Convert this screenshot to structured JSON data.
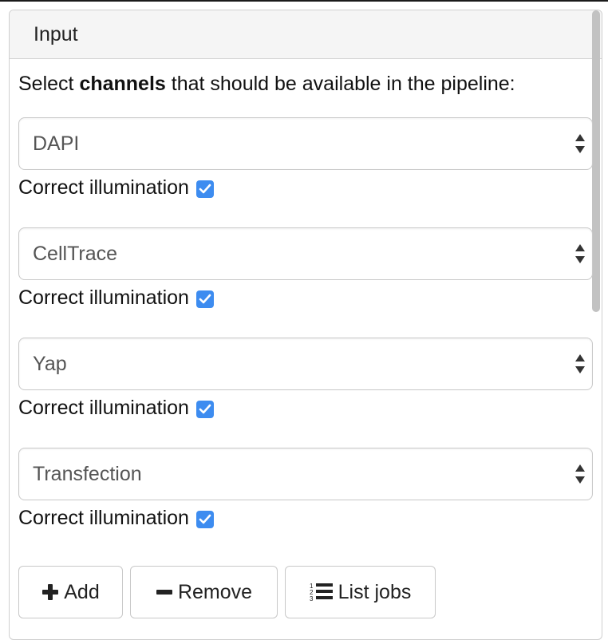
{
  "panel": {
    "title": "Input",
    "instruction_prefix": "Select ",
    "instruction_bold": "channels",
    "instruction_suffix": " that should be available in the pipeline:"
  },
  "channels": [
    {
      "value": "DAPI",
      "checkbox_label": "Correct illumination",
      "checked": true
    },
    {
      "value": "CellTrace",
      "checkbox_label": "Correct illumination",
      "checked": true
    },
    {
      "value": "Yap",
      "checkbox_label": "Correct illumination",
      "checked": true
    },
    {
      "value": "Transfection",
      "checkbox_label": "Correct illumination",
      "checked": true
    }
  ],
  "buttons": {
    "add_label": "Add",
    "remove_label": "Remove",
    "list_jobs_label": "List jobs"
  },
  "colors": {
    "checkbox": "#3d8cf0",
    "header_bg": "#f5f5f5"
  },
  "icons": {
    "add": "plus-icon",
    "remove": "minus-icon",
    "list_jobs": "ordered-list-icon",
    "select": "up-down-arrows-icon"
  }
}
